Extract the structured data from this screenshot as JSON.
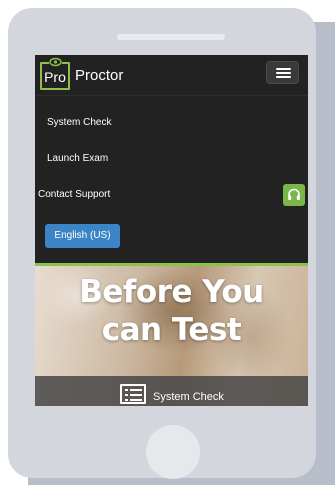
{
  "logo": {
    "box_text": "Pro",
    "text": "Proctor"
  },
  "menu": {
    "toggle_icon": "hamburger-icon",
    "items": [
      {
        "label": "System Check"
      },
      {
        "label": "Launch Exam"
      },
      {
        "label": "Contact Support",
        "icon": "headset-icon"
      }
    ],
    "language_button": "English  (US)"
  },
  "hero": {
    "title_line1": "Before You",
    "title_line2": "can Test",
    "band_icon": "checklist-icon",
    "band_label": "System Check"
  },
  "colors": {
    "brand_green": "#8bc34a",
    "support_green": "#7ab648",
    "language_blue": "#3a84c7",
    "navbar_bg": "#222222",
    "phone_frame": "#d3d6dd"
  }
}
